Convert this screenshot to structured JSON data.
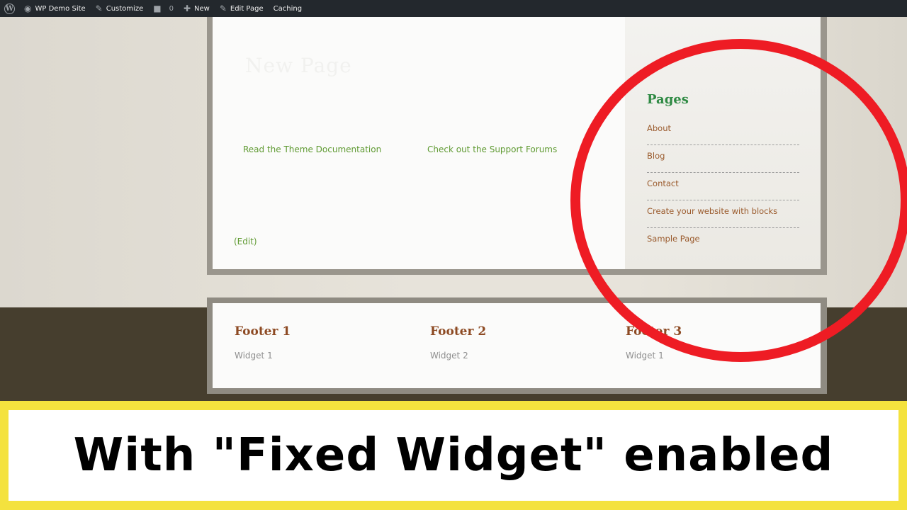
{
  "admin_bar": {
    "items": [
      {
        "label": "WP Demo Site",
        "icon": "dashboard-icon"
      },
      {
        "label": "Customize",
        "icon": "brush-icon"
      },
      {
        "label": "0",
        "icon": "comment-icon"
      },
      {
        "label": "New",
        "icon": "plus-icon"
      },
      {
        "label": "Edit Page",
        "icon": "pencil-icon"
      },
      {
        "label": "Caching"
      }
    ]
  },
  "content": {
    "title": "New Page",
    "links": [
      "Read the Theme Documentation",
      "Check out the Support Forums"
    ],
    "edit_label": "(Edit)"
  },
  "sidebar": {
    "title": "Pages",
    "items": [
      "About",
      "Blog",
      "Contact",
      "Create your website with blocks",
      "Sample Page"
    ]
  },
  "footer": {
    "columns": [
      {
        "title": "Footer 1",
        "widget": "Widget 1"
      },
      {
        "title": "Footer 2",
        "widget": "Widget 2"
      },
      {
        "title": "Footer 3",
        "widget": "Widget 1"
      }
    ]
  },
  "caption": {
    "text": "With \"Fixed Widget\" enabled"
  },
  "colors": {
    "annotation_red": "#ee1c24",
    "banner_yellow": "#f4e23e",
    "sidebar_heading": "#2f8a44",
    "link_brown": "#9a5a2c",
    "link_green": "#5f9a32"
  }
}
